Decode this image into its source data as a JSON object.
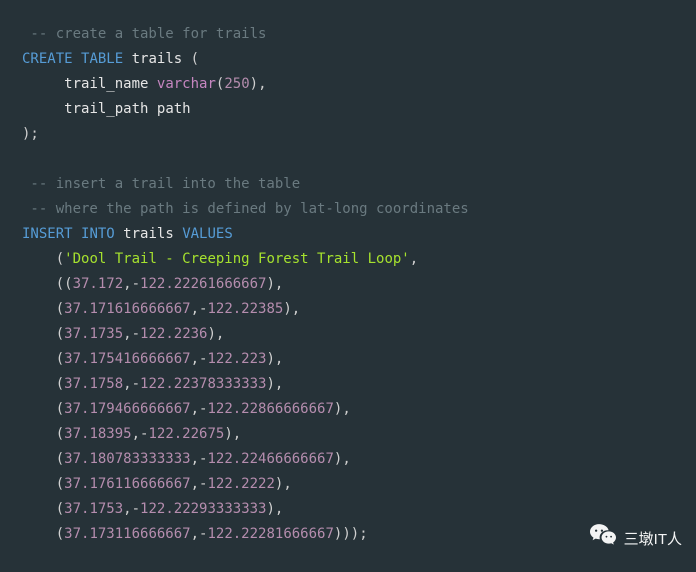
{
  "code": {
    "c1": " -- create a table for trails",
    "kw_create": "CREATE",
    "kw_table": "TABLE",
    "id_trails": "trails",
    "id_trail_name": "trail_name",
    "ty_varchar": "varchar",
    "num_250": "250",
    "id_trail_path": "trail_path",
    "id_path": "path",
    "c2": " -- insert a trail into the table",
    "c3": " -- where the path is defined by lat-long coordinates",
    "kw_insert": "INSERT",
    "kw_into": "INTO",
    "kw_values": "VALUES",
    "str_name": "'Dool Trail - Creeping Forest Trail Loop'",
    "p1a": "37.172",
    "p1b": "122.22261666667",
    "p2a": "37.171616666667",
    "p2b": "122.22385",
    "p3a": "37.1735",
    "p3b": "122.2236",
    "p4a": "37.175416666667",
    "p4b": "122.223",
    "p5a": "37.1758",
    "p5b": "122.22378333333",
    "p6a": "37.179466666667",
    "p6b": "122.22866666667",
    "p7a": "37.18395",
    "p7b": "122.22675",
    "p8a": "37.180783333333",
    "p8b": "122.22466666667",
    "p9a": "37.176116666667",
    "p9b": "122.2222",
    "p10a": "37.1753",
    "p10b": "122.22293333333",
    "p11a": "37.173116666667",
    "p11b": "122.22281666667"
  },
  "watermark": {
    "text": "三墩IT人"
  }
}
